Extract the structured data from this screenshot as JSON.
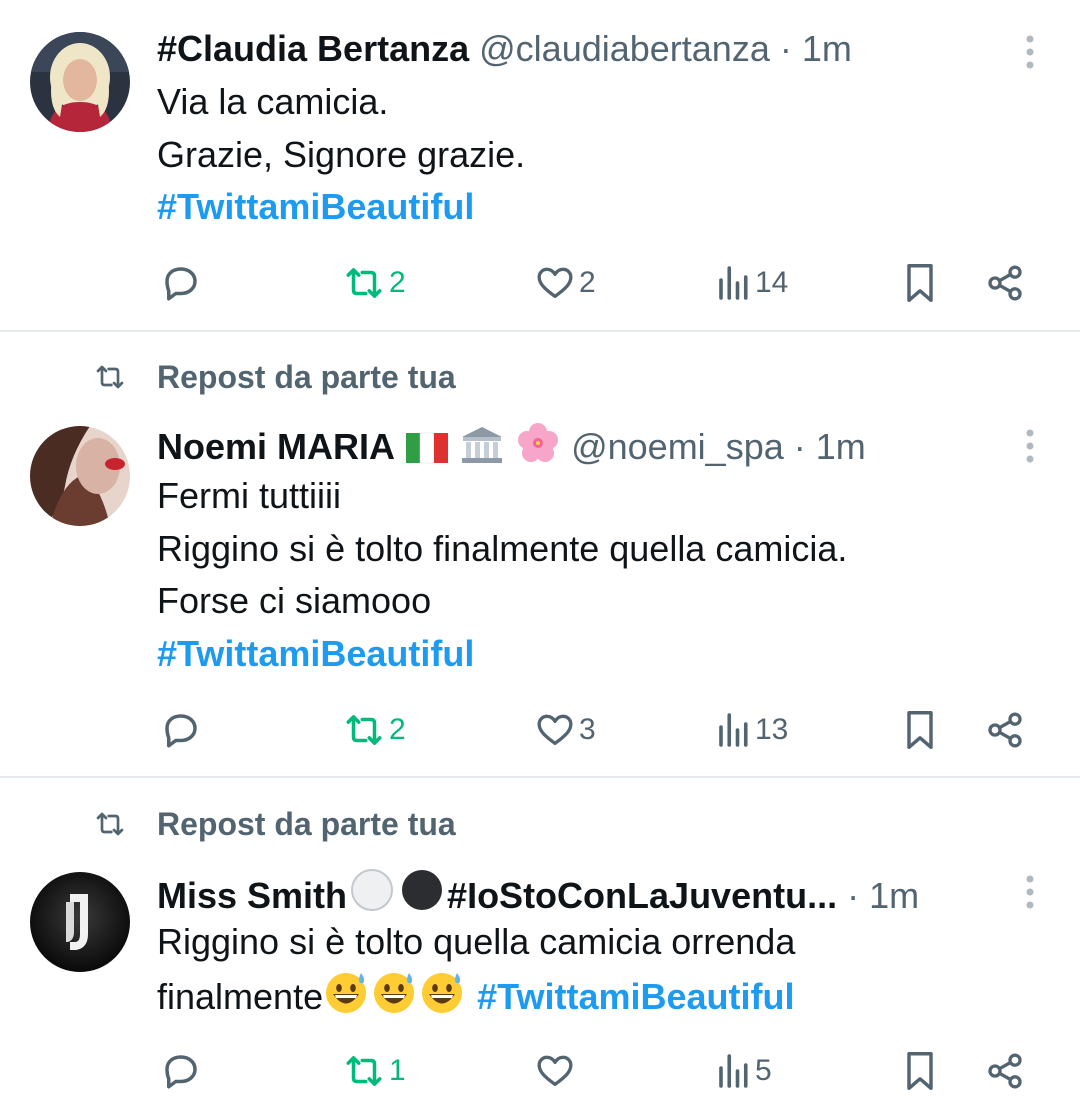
{
  "timeline": {
    "tweets": [
      {
        "display_name": "#Claudia Bertanza",
        "handle": "@claudiabertanza",
        "separator": "·",
        "time": "1m",
        "lines": [
          "Via la camicia.",
          "Grazie, Signore grazie."
        ],
        "hashtag": "#TwittamiBeautiful",
        "retweets": "2",
        "likes": "2",
        "views": "14"
      },
      {
        "repost_label": "Repost da parte tua",
        "display_name": "Noemi MARIA",
        "name_emojis": [
          "italy-flag",
          "classical-building",
          "cherry-blossom"
        ],
        "handle": "@noemi_spa",
        "separator": "·",
        "time": "1m",
        "lines": [
          "Fermi tuttiiii",
          "Riggino si è tolto finalmente quella camicia.",
          "Forse ci siamooo"
        ],
        "hashtag": "#TwittamiBeautiful",
        "retweets": "2",
        "likes": "3",
        "views": "13"
      },
      {
        "repost_label": "Repost da parte tua",
        "display_name_prefix": "Miss Smith",
        "name_emojis": [
          "white-circle",
          "black-circle"
        ],
        "display_name_suffix": "#IoStoConLaJuventu...",
        "separator": "·",
        "time": "1m",
        "line1": "Riggino si è tolto quella camicia orrenda",
        "line2_text": "finalmente",
        "line2_emojis": [
          "grinning-sweat-face",
          "grinning-sweat-face",
          "grinning-sweat-face"
        ],
        "hashtag": "#TwittamiBeautiful",
        "retweets": "1",
        "likes": "",
        "views": "5"
      }
    ]
  },
  "colors": {
    "text": "#0f1419",
    "secondary": "#536471",
    "hashtag": "#1d9bf0",
    "repost_green": "#00ba7c",
    "divider": "#e6e9ec"
  }
}
